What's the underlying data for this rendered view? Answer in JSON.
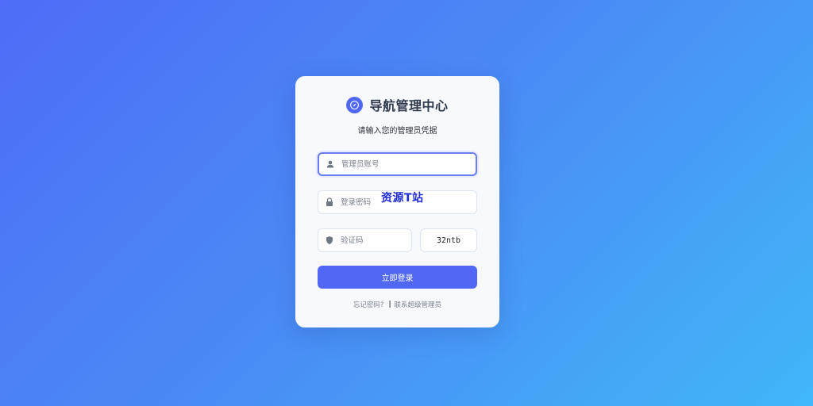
{
  "brand": {
    "title": "导航管理中心",
    "icon": "compass-icon",
    "accent_color": "#4f67f2"
  },
  "subtitle": "请输入您的管理员凭据",
  "form": {
    "username": {
      "placeholder": "管理员账号",
      "value": "",
      "icon": "user-icon"
    },
    "password": {
      "placeholder": "登录密码",
      "value": "",
      "icon": "lock-icon"
    },
    "captcha_input": {
      "placeholder": "验证码",
      "value": "",
      "icon": "shield-icon"
    },
    "captcha_code": "32ntb",
    "submit_label": "立即登录",
    "button_color": "#5068f3"
  },
  "watermark": "资源T站",
  "links": {
    "forgot_password": "忘记密码?",
    "separator": "|",
    "contact_admin": "联系超级管理员"
  }
}
